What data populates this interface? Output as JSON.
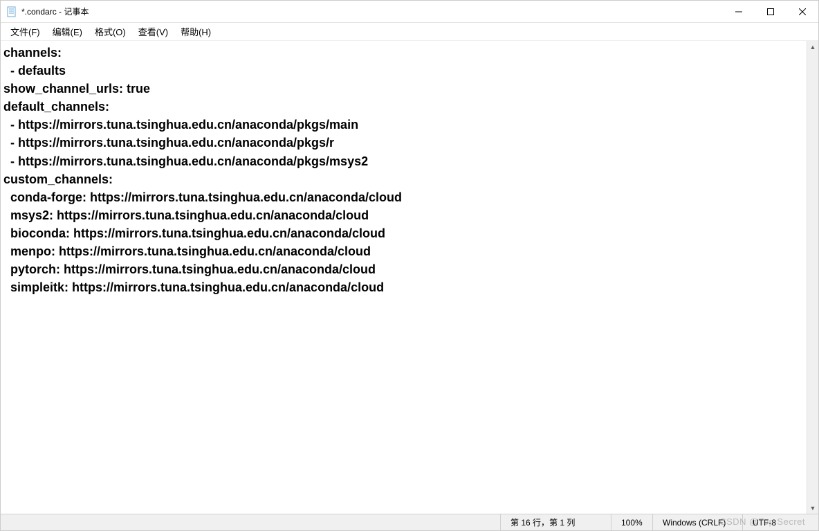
{
  "window": {
    "title": "*.condarc - 记事本"
  },
  "menus": {
    "file": "文件(F)",
    "edit": "编辑(E)",
    "format": "格式(O)",
    "view": "查看(V)",
    "help": "帮助(H)"
  },
  "editor": {
    "text": "channels:\n  - defaults\nshow_channel_urls: true\ndefault_channels:\n  - https://mirrors.tuna.tsinghua.edu.cn/anaconda/pkgs/main\n  - https://mirrors.tuna.tsinghua.edu.cn/anaconda/pkgs/r\n  - https://mirrors.tuna.tsinghua.edu.cn/anaconda/pkgs/msys2\ncustom_channels:\n  conda-forge: https://mirrors.tuna.tsinghua.edu.cn/anaconda/cloud\n  msys2: https://mirrors.tuna.tsinghua.edu.cn/anaconda/cloud\n  bioconda: https://mirrors.tuna.tsinghua.edu.cn/anaconda/cloud\n  menpo: https://mirrors.tuna.tsinghua.edu.cn/anaconda/cloud\n  pytorch: https://mirrors.tuna.tsinghua.edu.cn/anaconda/cloud\n  simpleitk: https://mirrors.tuna.tsinghua.edu.cn/anaconda/cloud"
  },
  "status": {
    "cursor": "第 16 行，第 1 列",
    "zoom": "100%",
    "line_ending": "Windows (CRLF)",
    "encoding": "UTF-8"
  },
  "watermark": "CSDN @Top Secret"
}
